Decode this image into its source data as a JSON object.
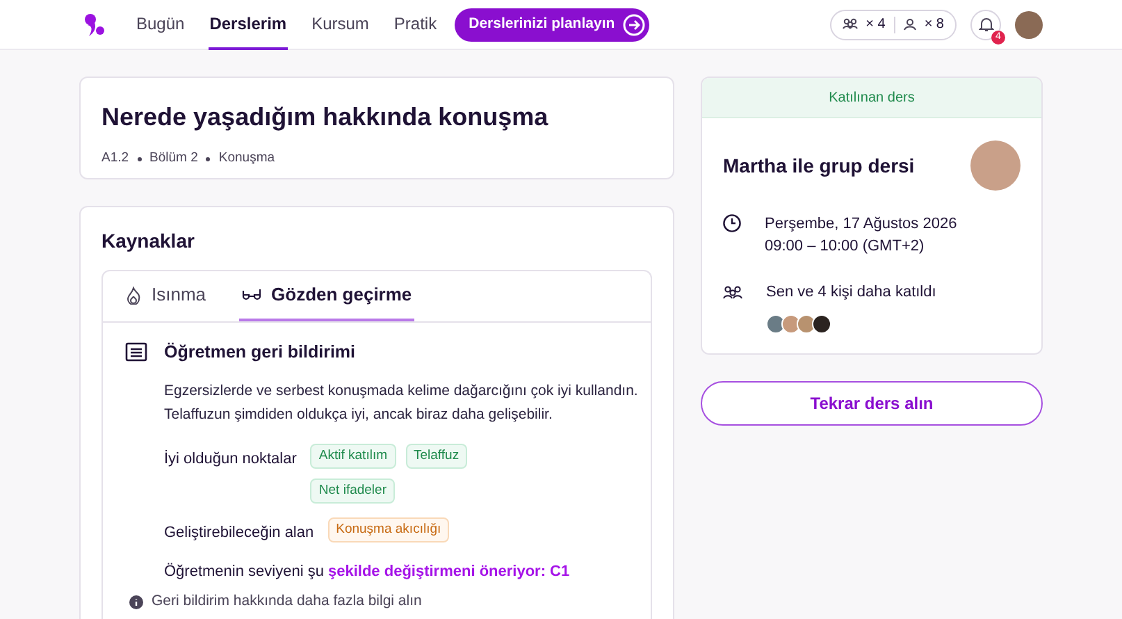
{
  "nav": {
    "items": [
      {
        "label": "Bugün",
        "selected": false
      },
      {
        "label": "Derslerim",
        "selected": true
      },
      {
        "label": "Kursum",
        "selected": false
      },
      {
        "label": "Pratik",
        "selected": false
      }
    ],
    "cta": "Derslerinizi planlayın",
    "group_count": "× 4",
    "private_count": "× 8",
    "notification_badge": "4"
  },
  "lesson": {
    "title": "Nerede yaşadığım hakkında konuşma",
    "meta": [
      "A1.2",
      "Bölüm 2",
      "Konuşma"
    ]
  },
  "resources": {
    "title": "Kaynaklar",
    "tabs": [
      {
        "label": "Isınma",
        "selected": false,
        "kind": "warmup"
      },
      {
        "label": "Gözden geçirme",
        "selected": true,
        "kind": "review"
      }
    ],
    "feedback": {
      "title": "Öğretmen geri bildirimi",
      "text": "Egzersizlerde ve serbest konuşmada kelime dağarcığını çok iyi kullandın. Telaffuzun şimdiden oldukça iyi, ancak biraz daha gelişebilir.",
      "groups": [
        {
          "label": "İyi olduğun noktalar",
          "kind": "strength",
          "tags": [
            "Aktif katılım",
            "Telaffuz",
            "Net ifadeler"
          ]
        },
        {
          "label": "Geliştirebileceğin alan",
          "kind": "improve",
          "tags": [
            "Konuşma akıcılığı"
          ]
        }
      ],
      "level_text": "Öğretmenin seviyeni şu ",
      "level_link": "şekilde değiştirmeni öneriyor: C1",
      "more_info": "Geri bildirim hakkında daha fazla bilgi alın"
    }
  },
  "class_card": {
    "status": "Katılınan ders",
    "title": "Martha ile grup dersi",
    "date": "Perşembe, 17 Ağustos 2026",
    "time": "09:00 – 10:00 (GMT+2)",
    "attendees": "Sen ve 4 kişi daha katıldı"
  },
  "rebook_button": "Tekrar ders alın"
}
